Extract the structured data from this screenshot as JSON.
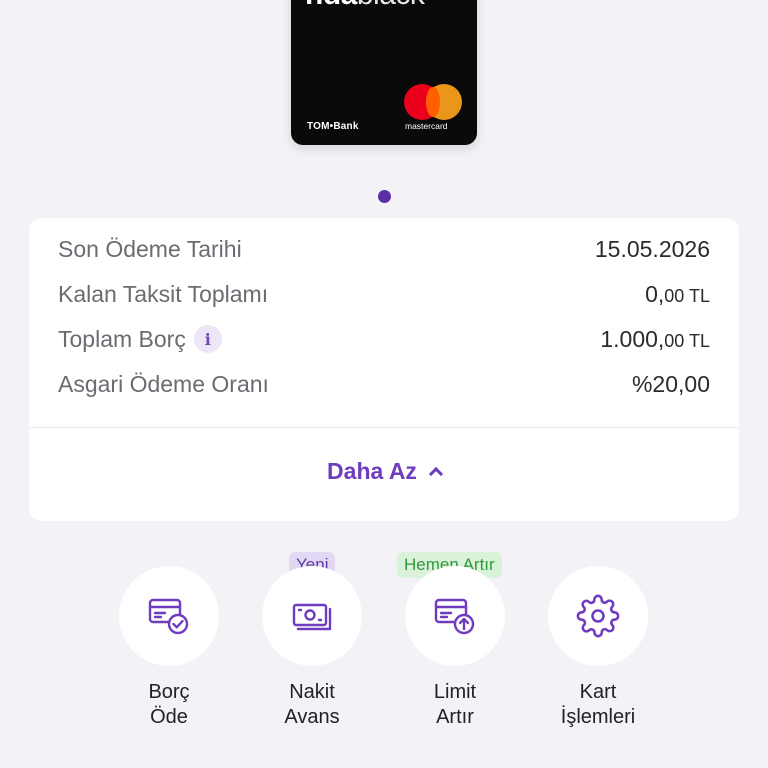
{
  "card": {
    "brand_bold": "nda",
    "brand_light": "black",
    "bank": "TOM•Bank",
    "network": "mastercard"
  },
  "details": {
    "rows": [
      {
        "label": "Son Ödeme Tarihi",
        "value": "15.05.2026"
      },
      {
        "label": "Kalan Taksit Toplamı",
        "value_main": "0,",
        "value_small": "00 TL"
      },
      {
        "label": "Toplam Borç",
        "value_main": "1.000,",
        "value_small": "00 TL",
        "info": "i"
      },
      {
        "label": "Asgari Ödeme Oranı",
        "value": "%20,00"
      }
    ],
    "toggle_label": "Daha Az"
  },
  "actions": [
    {
      "line1": "Borç",
      "line2": "Öde",
      "icon": "card-check-icon"
    },
    {
      "line1": "Nakit",
      "line2": "Avans",
      "icon": "cash-icon",
      "badge": "Yeni"
    },
    {
      "line1": "Limit",
      "line2": "Artır",
      "icon": "card-up-icon",
      "badge": "Hemen Artır"
    },
    {
      "line1": "Kart",
      "line2": "İşlemleri",
      "icon": "gear-icon"
    }
  ],
  "colors": {
    "accent": "#6f3cc0",
    "background": "#f2f2f7",
    "badge_new_bg": "#e2d8f3",
    "badge_limit_bg": "#d9f2d9",
    "badge_limit_text": "#2f9a3a"
  }
}
